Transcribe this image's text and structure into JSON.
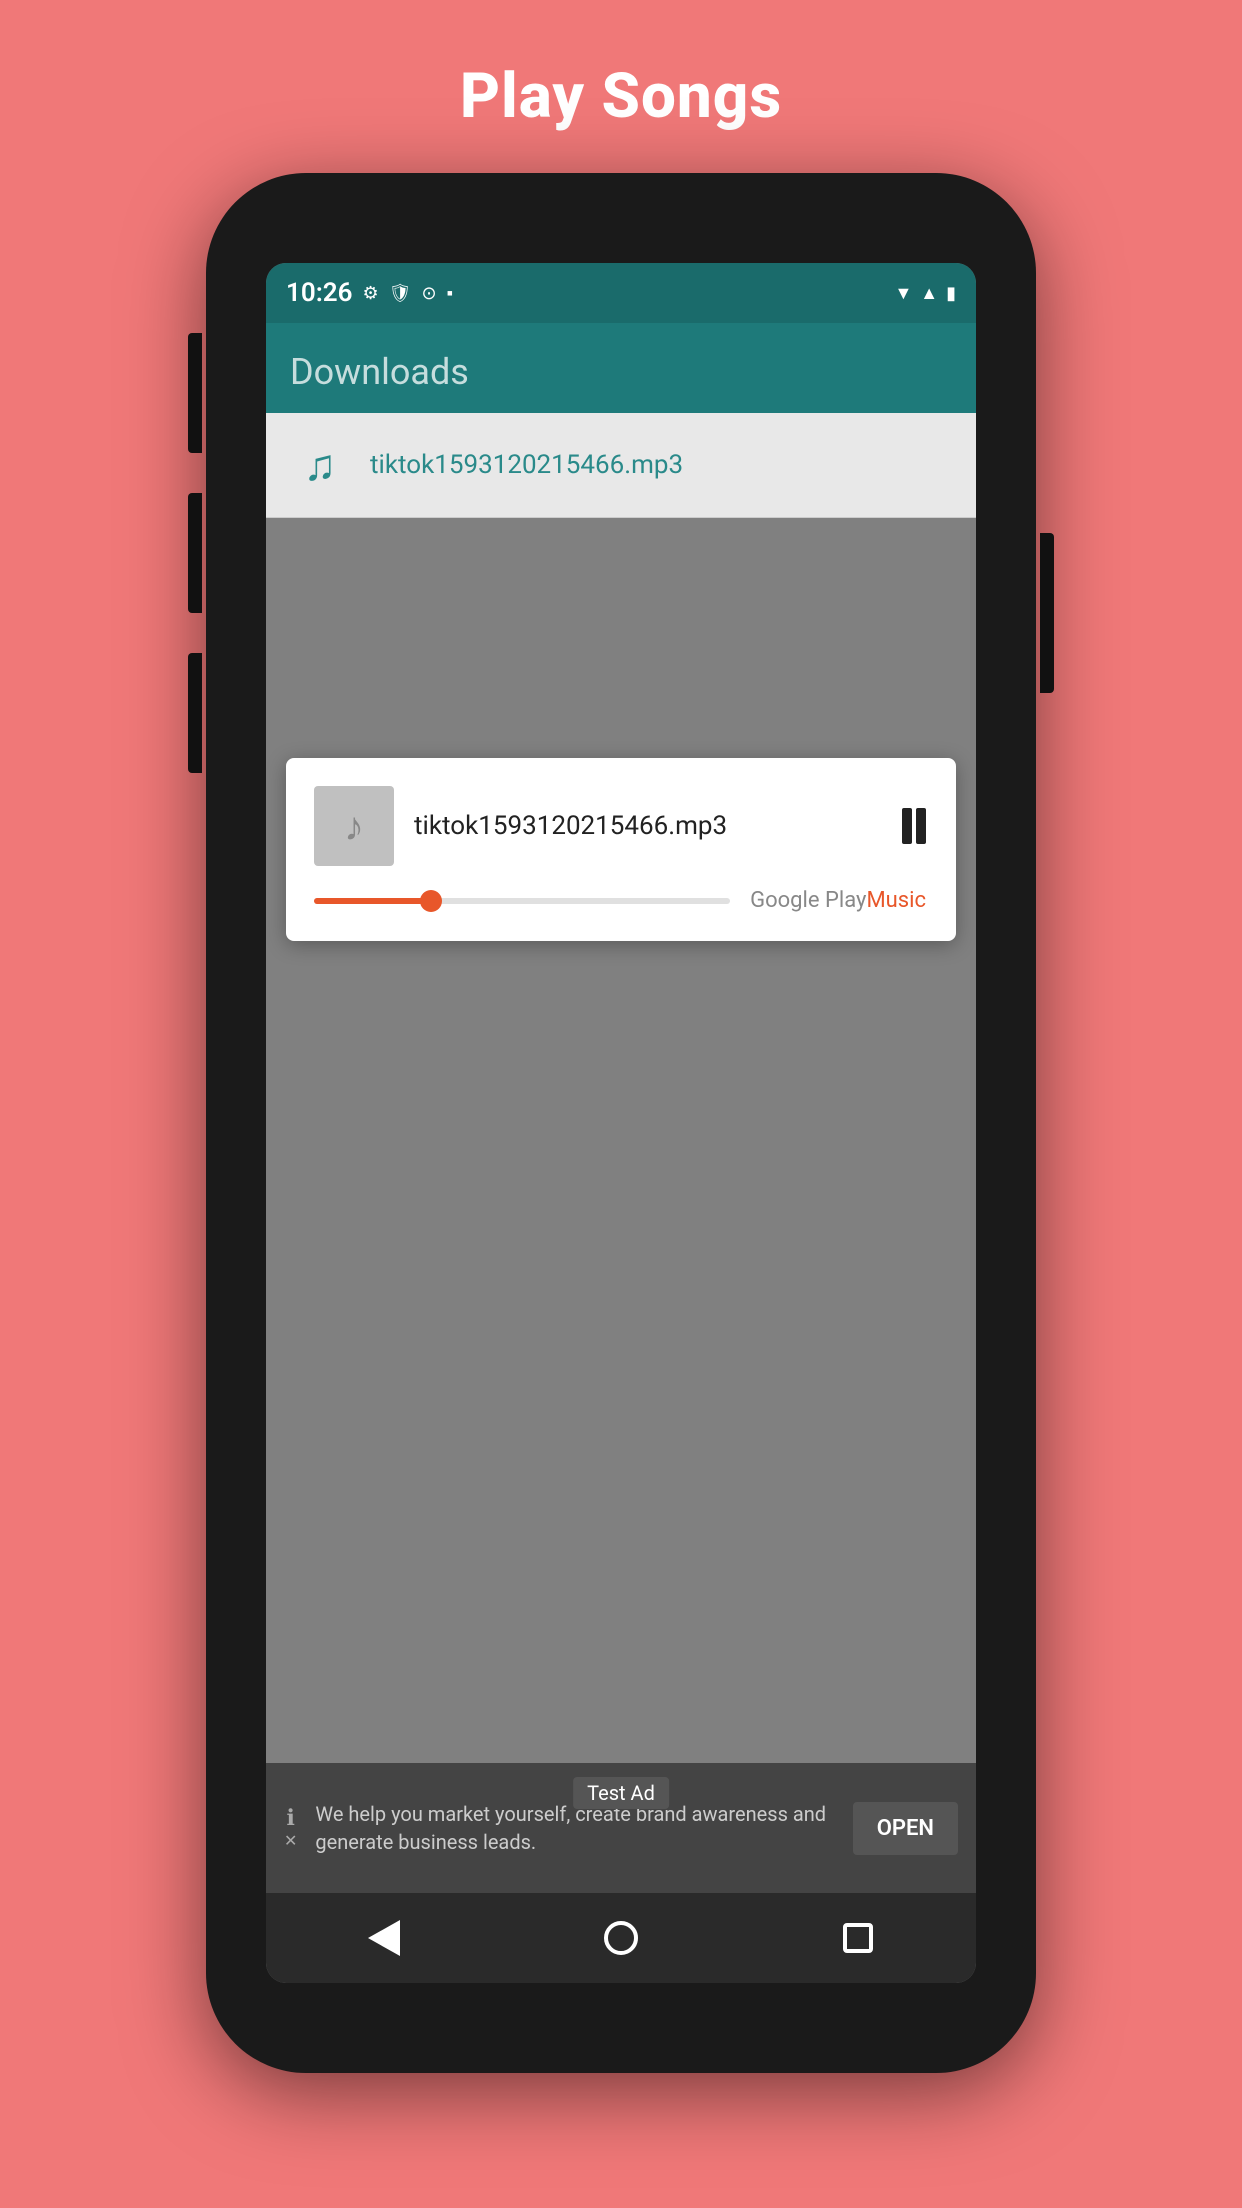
{
  "page": {
    "title": "Play Songs",
    "background_color": "#F07878"
  },
  "status_bar": {
    "time": "10:26",
    "icons_left": [
      "gear-icon",
      "shield-icon",
      "sync-icon",
      "clipboard-icon"
    ],
    "icons_right": [
      "wifi-icon",
      "signal-icon",
      "battery-icon"
    ],
    "background_color": "#1a6b6b"
  },
  "app_bar": {
    "title": "Downloads",
    "background_color": "#1e7a7a"
  },
  "download_item": {
    "filename": "tiktok1593120215466.mp3",
    "icon": "music-note"
  },
  "media_player": {
    "filename": "tiktok1593120215466.mp3",
    "progress_percent": 28,
    "state": "playing",
    "source_google": "Google Play ",
    "source_music": "Music",
    "pause_label": "⏸"
  },
  "ad_bar": {
    "badge": "Test Ad",
    "text": "We help you market yourself, create brand awareness and generate business leads.",
    "open_button": "OPEN",
    "info_icon": "ℹ",
    "close_icon": "✕"
  },
  "nav_bar": {
    "back_label": "◀",
    "home_label": "⬤",
    "recent_label": "▪"
  }
}
